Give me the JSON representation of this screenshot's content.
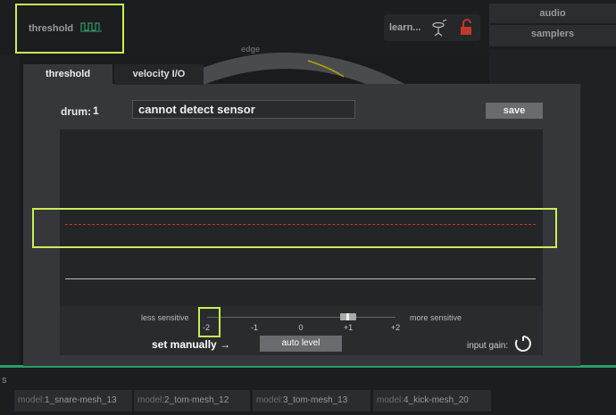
{
  "top_bar": {
    "threshold_label": "threshold",
    "threshold_icon": "waveform-icon",
    "learn_label": "learn...",
    "learn_icon": "drum-stand-icon",
    "lock_icon": "lock-icon"
  },
  "right_tabs": {
    "audio": "audio",
    "samplers": "samplers"
  },
  "zone_label": "edge",
  "dialog": {
    "tabs": [
      "threshold",
      "velocity I/O"
    ],
    "active_tab": "threshold",
    "drum_label": "drum:",
    "drum_number": "1",
    "sensor_status": "cannot detect sensor",
    "save_label": "save",
    "less_sensitive": "less sensitive",
    "more_sensitive": "more sensitive",
    "slider_ticks": [
      "-2",
      "-1",
      "0",
      "+1",
      "+2"
    ],
    "slider_value": 1,
    "set_manually": "set manually →",
    "auto_level_label": "auto level",
    "input_gain_label": "input gain:"
  },
  "bottom_bar": {
    "left_letter": "s",
    "models": [
      {
        "prefix": "model:",
        "name": "1_snare-mesh_13"
      },
      {
        "prefix": "model:",
        "name": "2_tom-mesh_12"
      },
      {
        "prefix": "model:",
        "name": "3_tom-mesh_13"
      },
      {
        "prefix": "model:",
        "name": "4_kick-mesh_20"
      }
    ]
  },
  "colors": {
    "highlight": "#c7ef57",
    "threshold_line": "#c0392b",
    "accent_green": "#2a9d6a",
    "lock_red": "#c0392b"
  }
}
